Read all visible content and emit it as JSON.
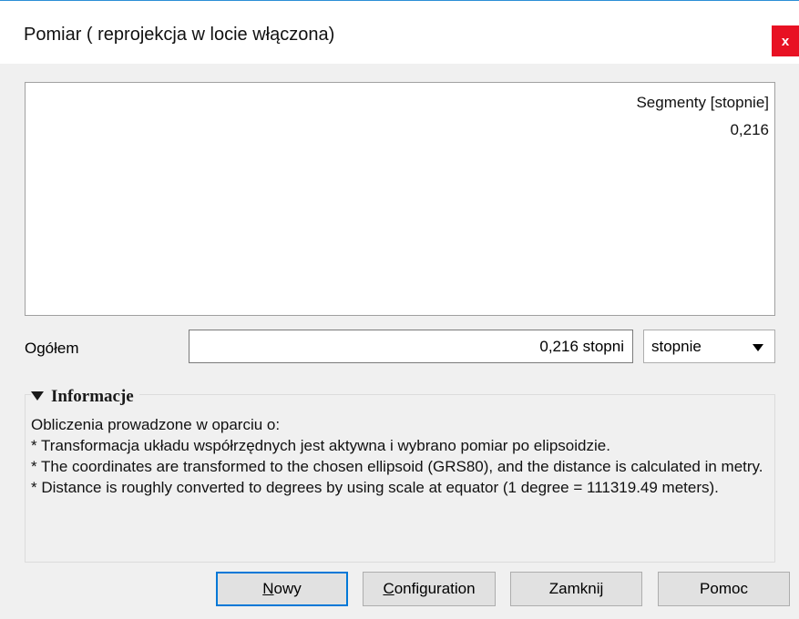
{
  "window": {
    "title": "Pomiar ( reprojekcja w locie włączona)",
    "close_label": "x",
    "accent_color": "#e81123"
  },
  "results_table": {
    "column_header": "Segmenty [stopnie]",
    "rows": [
      "0,216"
    ]
  },
  "total": {
    "label": "Ogółem",
    "value": "0,216 stopni",
    "unit_selected": "stopnie"
  },
  "info": {
    "header": "Informacje",
    "lines": [
      "Obliczenia prowadzone w oparciu o:",
      "* Transformacja układu współrzędnych jest aktywna i wybrano pomiar po elipsoidzie.",
      "* The coordinates are transformed to the chosen ellipsoid (GRS80), and the distance is calculated in metry.",
      "* Distance is roughly converted to degrees by using scale at equator (1 degree = 111319.49 meters)."
    ]
  },
  "buttons": {
    "new_mnemonic": "N",
    "new_rest": "owy",
    "config_mnemonic": "C",
    "config_rest": "onfiguration",
    "close": "Zamknij",
    "help": "Pomoc"
  }
}
